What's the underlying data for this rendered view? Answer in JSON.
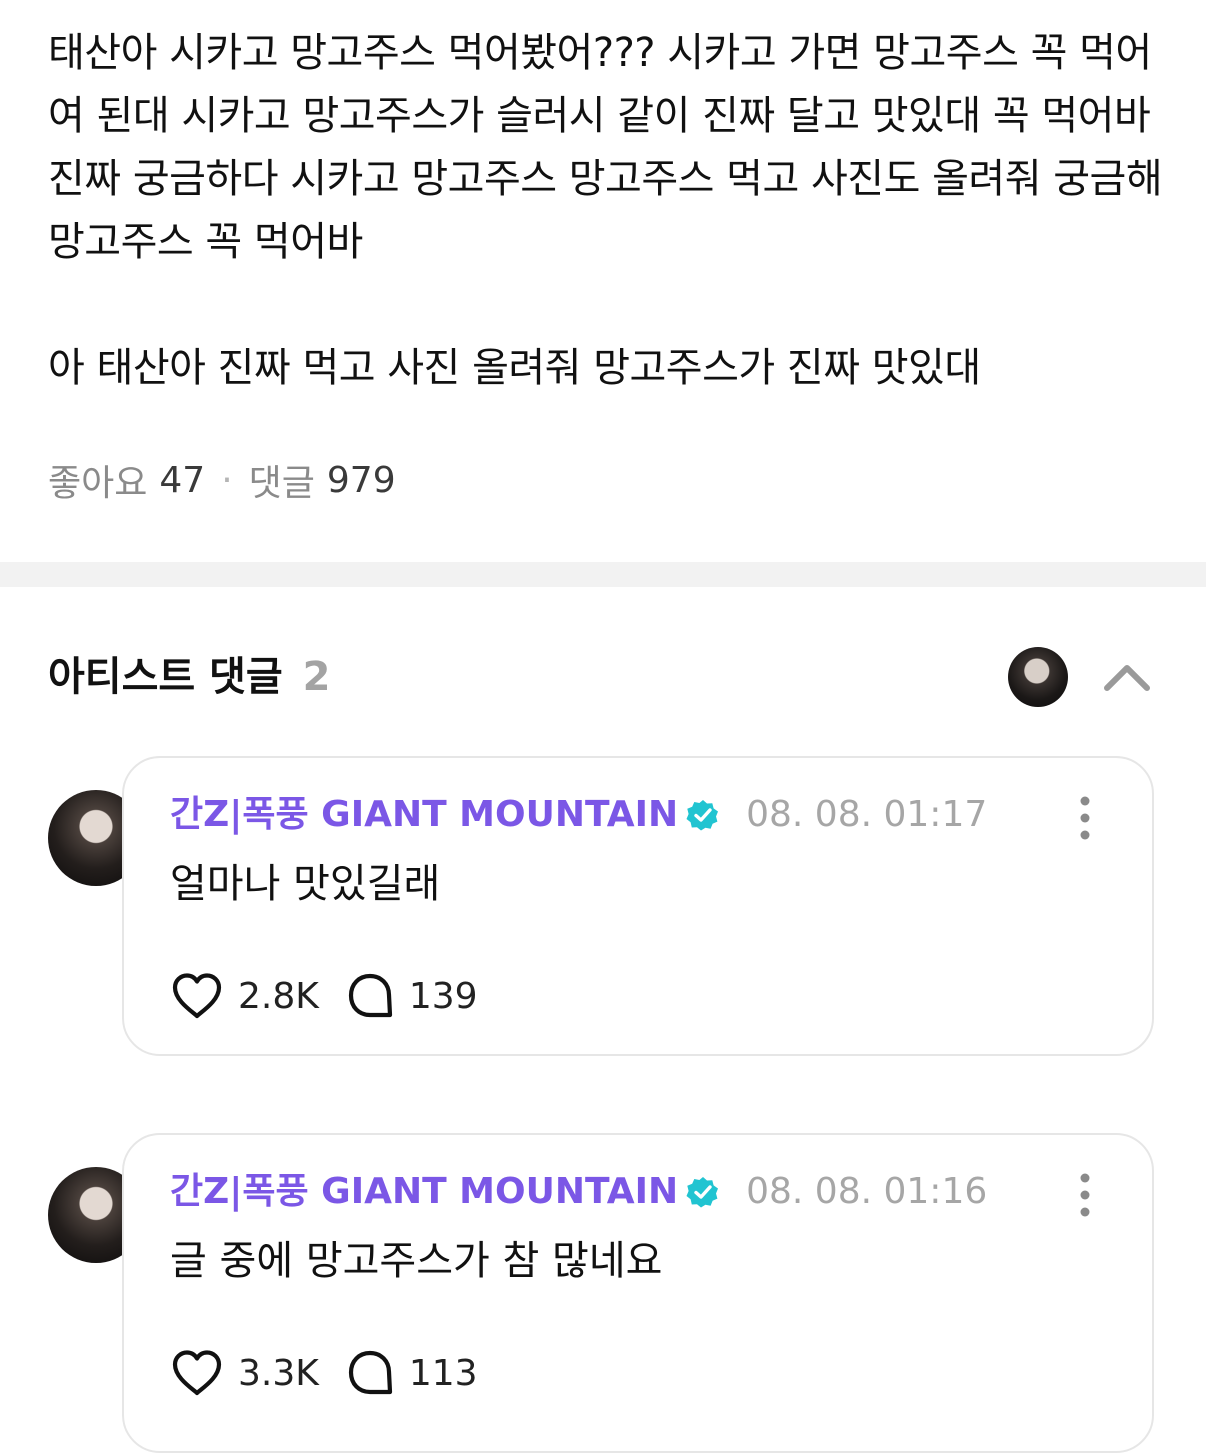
{
  "post": {
    "paragraphs": [
      "태산아 시카고 망고주스 먹어봤어??? 시카고 가면 망고주스 꼭 먹어여 된대 시카고 망고주스가 슬러시 같이 진짜 달고 맛있대 꼭 먹어바 진짜 궁금하다 시카고 망고주스 망고주스 먹고 사진도 올려줘 궁금해 망고주스 꼭 먹어바",
      "아 태산아 진짜 먹고 사진 올려줘 망고주스가 진짜 맛있대"
    ],
    "likes_label": "좋아요",
    "likes_count": "47",
    "separator": "·",
    "comments_label": "댓글",
    "comments_count": "979"
  },
  "artist_comments": {
    "title": "아티스트 댓글",
    "count": "2",
    "comments": [
      {
        "author": "간Z|폭풍 GIANT MOUNTAIN",
        "time": "08. 08. 01:17",
        "text": "얼마나 맛있길래",
        "likes": "2.8K",
        "replies": "139"
      },
      {
        "author": "간Z|폭풍 GIANT MOUNTAIN",
        "time": "08. 08. 01:16",
        "text": "글 중에 망고주스가 참 많네요",
        "likes": "3.3K",
        "replies": "113"
      }
    ]
  },
  "icons": {
    "verified": "verified-badge-icon",
    "heart": "heart-icon",
    "reply": "speech-bubble-icon",
    "more": "more-vertical-icon",
    "collapse": "chevron-up-icon"
  },
  "colors": {
    "author": "#7b57e6",
    "verified": "#21c4d1",
    "muted": "#a6a6a6"
  }
}
